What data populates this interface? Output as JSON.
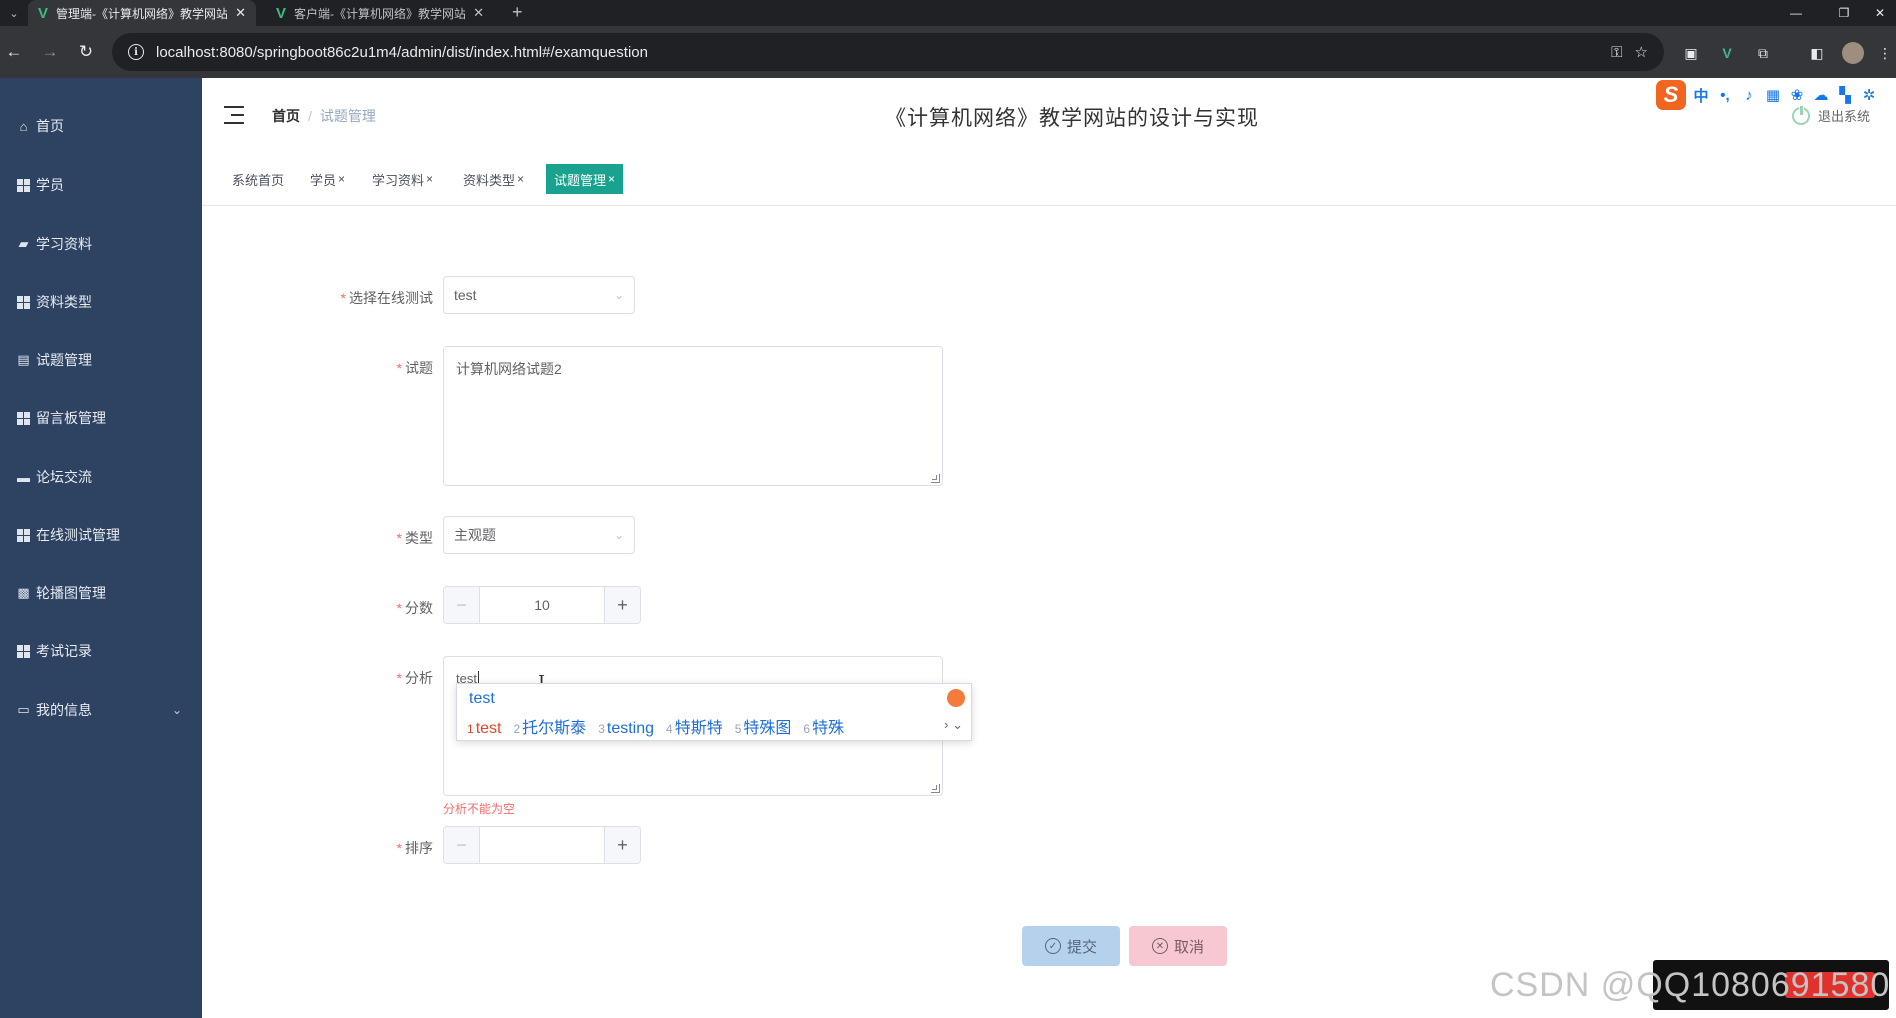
{
  "browser": {
    "tabs": [
      {
        "title": "管理端-《计算机网络》教学网站",
        "active": true
      },
      {
        "title": "客户端-《计算机网络》教学网站",
        "active": false
      }
    ],
    "url": "localhost:8080/springboot86c2u1m4/admin/dist/index.html#/examquestion"
  },
  "sidebar": {
    "items": [
      {
        "label": "首页",
        "icon": "home-icon"
      },
      {
        "label": "学员",
        "icon": "grid-icon"
      },
      {
        "label": "学习资料",
        "icon": "folder-icon"
      },
      {
        "label": "资料类型",
        "icon": "grid-icon"
      },
      {
        "label": "试题管理",
        "icon": "clipboard-icon"
      },
      {
        "label": "留言板管理",
        "icon": "grid-icon"
      },
      {
        "label": "论坛交流",
        "icon": "monitor-icon"
      },
      {
        "label": "在线测试管理",
        "icon": "grid-icon"
      },
      {
        "label": "轮播图管理",
        "icon": "image-icon"
      },
      {
        "label": "考试记录",
        "icon": "grid-icon"
      },
      {
        "label": "我的信息",
        "icon": "window-icon"
      }
    ]
  },
  "header": {
    "breadcrumb_home": "首页",
    "breadcrumb_separator": "/",
    "breadcrumb_current": "试题管理",
    "site_title": "《计算机网络》教学网站的设计与实现",
    "logout_label": "退出系统"
  },
  "tags": [
    {
      "label": "系统首页",
      "closable": false,
      "active": false
    },
    {
      "label": "学员",
      "closable": true,
      "active": false
    },
    {
      "label": "学习资料",
      "closable": true,
      "active": false
    },
    {
      "label": "资料类型",
      "closable": true,
      "active": false
    },
    {
      "label": "试题管理",
      "closable": true,
      "active": true
    }
  ],
  "tag_close_glyph": "×",
  "form": {
    "exam": {
      "label": "选择在线测试",
      "value": "test"
    },
    "question": {
      "label": "试题",
      "value": "计算机网络试题2"
    },
    "type": {
      "label": "类型",
      "value": "主观题"
    },
    "score": {
      "label": "分数",
      "value": "10"
    },
    "analysis": {
      "label": "分析",
      "value": "test",
      "error": "分析不能为空"
    },
    "sort": {
      "label": "排序",
      "value": ""
    }
  },
  "ime": {
    "composition": "test",
    "candidates": [
      {
        "n": "1",
        "text": "test"
      },
      {
        "n": "2",
        "text": "托尔斯泰"
      },
      {
        "n": "3",
        "text": "testing"
      },
      {
        "n": "4",
        "text": "特斯特"
      },
      {
        "n": "5",
        "text": "特殊图"
      },
      {
        "n": "6",
        "text": "特殊"
      }
    ],
    "toolbar_mode": "中"
  },
  "actions": {
    "submit_label": "提交",
    "cancel_label": "取消"
  },
  "watermark": "CSDN @QQ1080691580",
  "colors": {
    "sidebar": "#2e4262",
    "active_tag": "#19a38e",
    "required": "#f56c6c"
  }
}
